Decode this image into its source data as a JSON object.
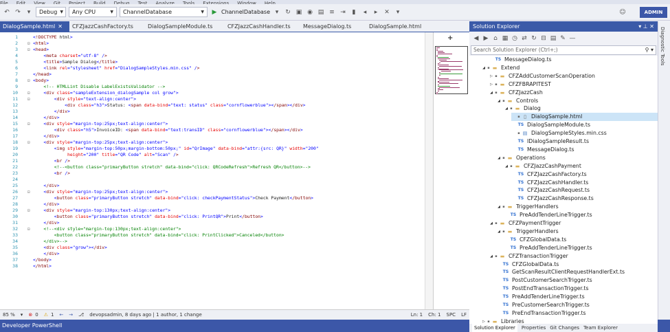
{
  "menubar": [
    "File",
    "Edit",
    "View",
    "Git",
    "Project",
    "Build",
    "Debug",
    "Test",
    "Analyze",
    "Tools",
    "Extensions",
    "Window",
    "Help"
  ],
  "toolbar": {
    "config": "Debug",
    "platform": "Any CPU",
    "project": "ChannelDatabase",
    "run_label": "ChannelDatabase",
    "account": "ADMIN"
  },
  "tabs": [
    {
      "label": "DialogSample.html",
      "active": true
    },
    {
      "label": "CFZJazzCashFactory.ts"
    },
    {
      "label": "DialogSampleModule.ts"
    },
    {
      "label": "CFZJazzCashHandler.ts"
    },
    {
      "label": "MessageDialog.ts"
    },
    {
      "label": "DialogSample.html"
    }
  ],
  "code_lines": [
    "<!DOCTYPE html>",
    "<html>",
    "<head>",
    "    <meta charset=\"utf-8\" />",
    "    <title>Sample Dialog</title>",
    "    <link rel=\"stylesheet\" href=\"DialogSampleStyles.min.css\" />",
    "</head>",
    "<body>",
    "    <!-- HTMLLint Disable LabelExistsValidator -->",
    "    <div class=\"sampleExtension_dialogSample col grow\">",
    "        <div style=\"text-align:center\">",
    "            <div class=\"h3\">Status: <span data-bind=\"text: status\" class=\"cornflowerblue\"></span></div>",
    "        </div>",
    "    </div>",
    "    <div style=\"margin-top:25px;text-align:center\">",
    "        <div class=\"h5\">InvoiceID: <span data-bind=\"text:transID\" class=\"cornflowerblue\"></span></div>",
    "    </div>",
    "    <div style=\"margin-top:25px;text-align:center\">",
    "        <img style=\"margin-top:50px;margin-bottom:50px;\" id=\"QrImage\" data-bind=\"attr:{src: QR}\" width=\"200\"",
    "             height=\"200\" title=\"QR Code\" alt=\"Scan\" />",
    "        <br />",
    "        <!--<button class=\"primaryButton stretch\" data-bind=\"click: QRCodeRefresh\">Refresh QR</button>-->",
    "        <br />",
    "",
    "    </div>",
    "    <div style=\"margin-top:25px;text-align:center\">",
    "        <button class=\"primaryButton stretch\" data-bind=\"click: checkPaymentStatus\">Check Payment</button>",
    "    </div>",
    "    <div style=\"margin-top:130px;text-align:center\">",
    "        <button class=\"primaryButton stretch\" data-bind=\"click: PrintQR\">Print</button>",
    "    </div>",
    "    <!--<div style=\"margin-top:130px;text-align:center\">",
    "        <button class=\"primaryButton stretch\" data-bind=\"click: PrintClicked\">Canceled</button>",
    "    </div>-->",
    "    <div class=\"grow\"></div>",
    "    </div>",
    "</body>",
    "</html>"
  ],
  "line_numbers": [
    "1",
    "2",
    "3",
    "4",
    "5",
    "6",
    "7",
    "8",
    "9",
    "10",
    "11",
    "12",
    "13",
    "14",
    "15",
    "16",
    "17",
    "18",
    "19",
    "20",
    "21",
    "22",
    "23",
    "24",
    "25",
    "26",
    "27",
    "28",
    "29",
    "30",
    "31",
    "32",
    "33",
    "34",
    "35",
    "36",
    "37",
    "38"
  ],
  "status": {
    "zoom": "85 %",
    "errors": "0",
    "warnings": "1",
    "blame": "devopsadmin, 8 days ago | 1 author, 1 change",
    "line": "Ln: 1",
    "col": "Ch: 1",
    "mode": "SPC",
    "eol": "LF"
  },
  "bottom_panel": {
    "label": "Developer PowerShell"
  },
  "solution_explorer": {
    "title": "Solution Explorer",
    "search_placeholder": "Search Solution Explorer (Ctrl+;)",
    "items": [
      {
        "label": "MessageDialog.ts",
        "depth": 2,
        "icon": "ts"
      },
      {
        "label": "Extend",
        "depth": 1,
        "icon": "folder",
        "expanded": true
      },
      {
        "label": "CFZAddCustomerScanOperation",
        "depth": 2,
        "icon": "folder",
        "expanded": false
      },
      {
        "label": "CFZFBRAPITEST",
        "depth": 2,
        "icon": "folder",
        "expanded": false
      },
      {
        "label": "CFZJazzCash",
        "depth": 2,
        "icon": "folder",
        "expanded": true
      },
      {
        "label": "Controls",
        "depth": 3,
        "icon": "folder",
        "expanded": true
      },
      {
        "label": "Dialog",
        "depth": 4,
        "icon": "folder",
        "expanded": true
      },
      {
        "label": "DialogSample.html",
        "depth": 5,
        "icon": "file",
        "selected": true
      },
      {
        "label": "DialogSampleModule.ts",
        "depth": 5,
        "icon": "ts"
      },
      {
        "label": "DialogSampleStyles.min.css",
        "depth": 5,
        "icon": "css"
      },
      {
        "label": "IDialogSampleResult.ts",
        "depth": 5,
        "icon": "ts"
      },
      {
        "label": "MessageDialog.ts",
        "depth": 5,
        "icon": "ts"
      },
      {
        "label": "Operations",
        "depth": 3,
        "icon": "folder",
        "expanded": true
      },
      {
        "label": "CFZJazzCashPayment",
        "depth": 4,
        "icon": "folder",
        "expanded": true
      },
      {
        "label": "CFZJazzCashFactory.ts",
        "depth": 5,
        "icon": "ts"
      },
      {
        "label": "CFZJazzCashHandler.ts",
        "depth": 5,
        "icon": "ts"
      },
      {
        "label": "CFZJazzCashRequest.ts",
        "depth": 5,
        "icon": "ts"
      },
      {
        "label": "CFZJazzCashResponse.ts",
        "depth": 5,
        "icon": "ts"
      },
      {
        "label": "TriggerHandlers",
        "depth": 3,
        "icon": "folder",
        "expanded": true
      },
      {
        "label": "PreAddTenderLineTrigger.ts",
        "depth": 4,
        "icon": "ts"
      },
      {
        "label": "CFZPaymentTrigger",
        "depth": 2,
        "icon": "folder",
        "expanded": true
      },
      {
        "label": "TriggerHandlers",
        "depth": 3,
        "icon": "folder",
        "expanded": true
      },
      {
        "label": "CFZGlobalData.ts",
        "depth": 4,
        "icon": "ts"
      },
      {
        "label": "PreAddTenderLineTrigger.ts",
        "depth": 4,
        "icon": "ts"
      },
      {
        "label": "CFZTransactionTrigger",
        "depth": 2,
        "icon": "folder",
        "expanded": true
      },
      {
        "label": "CFZGlobalData.ts",
        "depth": 3,
        "icon": "ts"
      },
      {
        "label": "GetScanResultClientRequestHandlerExt.ts",
        "depth": 3,
        "icon": "ts"
      },
      {
        "label": "PostCustomerSearchTrigger.ts",
        "depth": 3,
        "icon": "ts"
      },
      {
        "label": "PostEndTransactionTrigger.ts",
        "depth": 3,
        "icon": "ts"
      },
      {
        "label": "PreAddTenderLineTrigger.ts",
        "depth": 3,
        "icon": "ts"
      },
      {
        "label": "PreCustomerSearchTrigger.ts",
        "depth": 3,
        "icon": "ts"
      },
      {
        "label": "PreEndTransactionTrigger.ts",
        "depth": 3,
        "icon": "ts"
      },
      {
        "label": "Libraries",
        "depth": 1,
        "icon": "folder",
        "expanded": false
      }
    ],
    "bottom_tabs": [
      "Solution Explorer",
      "Properties",
      "Git Changes",
      "Team Explorer"
    ]
  },
  "right_strip_label": "Diagnostic Tools"
}
